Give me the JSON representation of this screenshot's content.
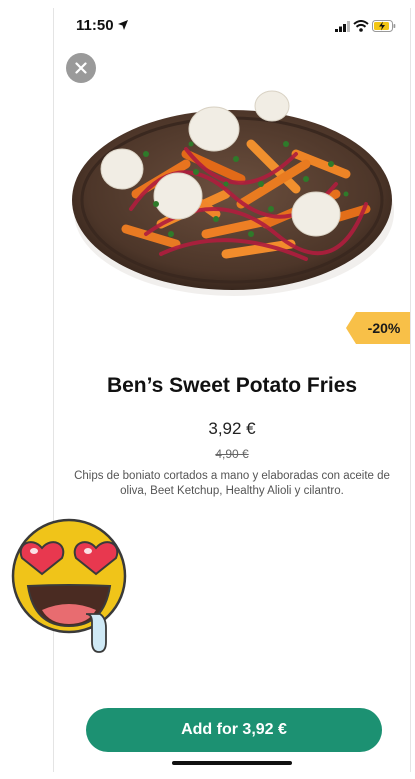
{
  "status_bar": {
    "time": "11:50",
    "icons": [
      "location-arrow-icon",
      "signal-icon",
      "wifi-icon",
      "battery-charging-icon"
    ]
  },
  "close_icon": "close-icon",
  "product": {
    "discount_badge": "-20%",
    "name": "Ben’s Sweet Potato Fries",
    "price": "3,92 €",
    "old_price": "4,90 €",
    "description": "Chips de boniato cortados a mano y elaboradas con aceite de oliva, Beet Ketchup, Healthy Alioli y cilantro."
  },
  "add_button_label": "Add for 3,92 €",
  "sticker": "heart-eyes-drooling-emoji",
  "colors": {
    "accent_button": "#1c9172",
    "discount_badge": "#f8c048",
    "close_button": "#9a9a9a"
  }
}
